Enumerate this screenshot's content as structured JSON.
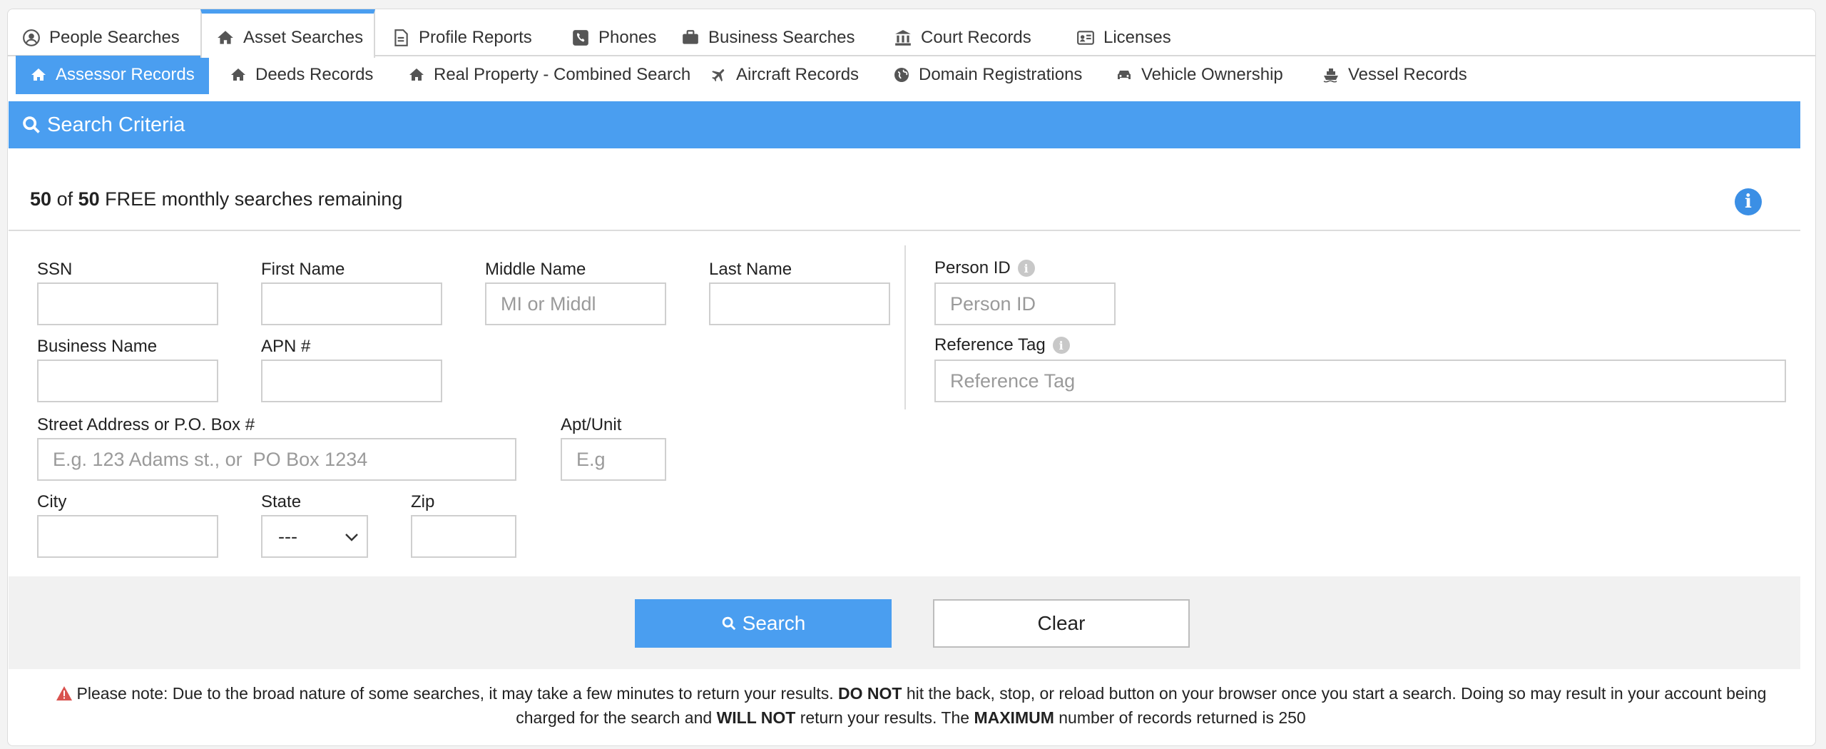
{
  "tabs": [
    {
      "label": "People Searches",
      "icon": "user-circle-icon"
    },
    {
      "label": "Asset Searches",
      "icon": "home-icon",
      "active": true
    },
    {
      "label": "Profile Reports",
      "icon": "document-icon"
    },
    {
      "label": "Phones",
      "icon": "phone-icon"
    },
    {
      "label": "Business Searches",
      "icon": "briefcase-icon"
    },
    {
      "label": "Court Records",
      "icon": "courthouse-icon"
    },
    {
      "label": "Licenses",
      "icon": "id-card-icon"
    }
  ],
  "subtabs": [
    {
      "label": "Assessor Records",
      "icon": "home-icon",
      "active": true
    },
    {
      "label": "Deeds Records",
      "icon": "home-icon"
    },
    {
      "label": "Real Property - Combined Search",
      "icon": "home-icon"
    },
    {
      "label": "Aircraft Records",
      "icon": "plane-icon"
    },
    {
      "label": "Domain Registrations",
      "icon": "globe-icon"
    },
    {
      "label": "Vehicle Ownership",
      "icon": "car-icon"
    },
    {
      "label": "Vessel Records",
      "icon": "ship-icon"
    }
  ],
  "criteria": {
    "title": "Search Criteria"
  },
  "remaining": {
    "used": "50",
    "of": "of",
    "total": "50",
    "text": "FREE monthly searches remaining"
  },
  "form": {
    "ssn": {
      "label": "SSN",
      "placeholder": ""
    },
    "first_name": {
      "label": "First Name",
      "placeholder": ""
    },
    "middle_name": {
      "label": "Middle Name",
      "placeholder": "MI or Middl"
    },
    "last_name": {
      "label": "Last Name",
      "placeholder": ""
    },
    "person_id": {
      "label": "Person ID",
      "placeholder": "Person ID"
    },
    "business_name": {
      "label": "Business Name",
      "placeholder": ""
    },
    "apn": {
      "label": "APN #",
      "placeholder": ""
    },
    "reference_tag": {
      "label": "Reference Tag",
      "placeholder": "Reference Tag"
    },
    "street": {
      "label": "Street Address or P.O. Box #",
      "placeholder": "E.g. 123 Adams st., or  PO Box 1234"
    },
    "apt": {
      "label": "Apt/Unit",
      "placeholder": "E.g"
    },
    "city": {
      "label": "City",
      "placeholder": ""
    },
    "state": {
      "label": "State",
      "value": "---"
    },
    "zip": {
      "label": "Zip",
      "placeholder": ""
    }
  },
  "actions": {
    "search_label": "Search",
    "clear_label": "Clear"
  },
  "note": {
    "part1": "Please note: Due to the broad nature of some searches, it may take a few minutes to return your results.",
    "bold1": "DO NOT",
    "part2": "hit the back, stop, or reload button on your browser once you start a search. Doing so may result in your account being charged for the search and",
    "bold2": "WILL NOT",
    "part3": "return your results. The",
    "bold3": "MAXIMUM",
    "part4": "number of records returned is 250"
  },
  "colors": {
    "accent": "#4a9ef0",
    "warning": "#d9534f"
  }
}
